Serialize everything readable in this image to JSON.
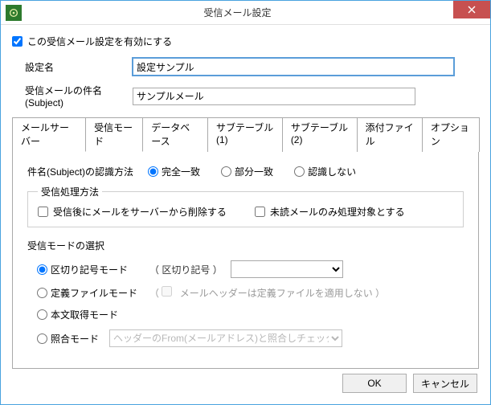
{
  "window": {
    "title": "受信メール設定"
  },
  "enable": {
    "label": "この受信メール設定を有効にする",
    "checked": true
  },
  "settingName": {
    "label": "設定名",
    "value": "設定サンプル"
  },
  "subject": {
    "label": "受信メールの件名(Subject)",
    "value": "サンプルメール"
  },
  "tabs": [
    "メールサーバー",
    "受信モード",
    "データベース",
    "サブテーブル(1)",
    "サブテーブル(2)",
    "添付ファイル",
    "オプション"
  ],
  "activeTab": 1,
  "recognize": {
    "label": "件名(Subject)の認識方法",
    "options": [
      "完全一致",
      "部分一致",
      "認識しない"
    ],
    "selected": 0
  },
  "proc": {
    "legend": "受信処理方法",
    "deleteAfter": {
      "label": "受信後にメールをサーバーから削除する",
      "checked": false
    },
    "unreadOnly": {
      "label": "未読メールのみ処理対象とする",
      "checked": false
    }
  },
  "modeSelect": {
    "title": "受信モードの選択",
    "options": [
      "区切り記号モード",
      "定義ファイルモード",
      "本文取得モード",
      "照合モード"
    ],
    "selected": 0,
    "delimLabel": "区切り記号",
    "delimValue": "",
    "defCheckbox": "メールヘッダーは定義ファイルを適用しない",
    "matchDropdown": "ヘッダーのFrom(メールアドレス)と照合しチェック"
  },
  "buttons": {
    "ok": "OK",
    "cancel": "キャンセル"
  }
}
